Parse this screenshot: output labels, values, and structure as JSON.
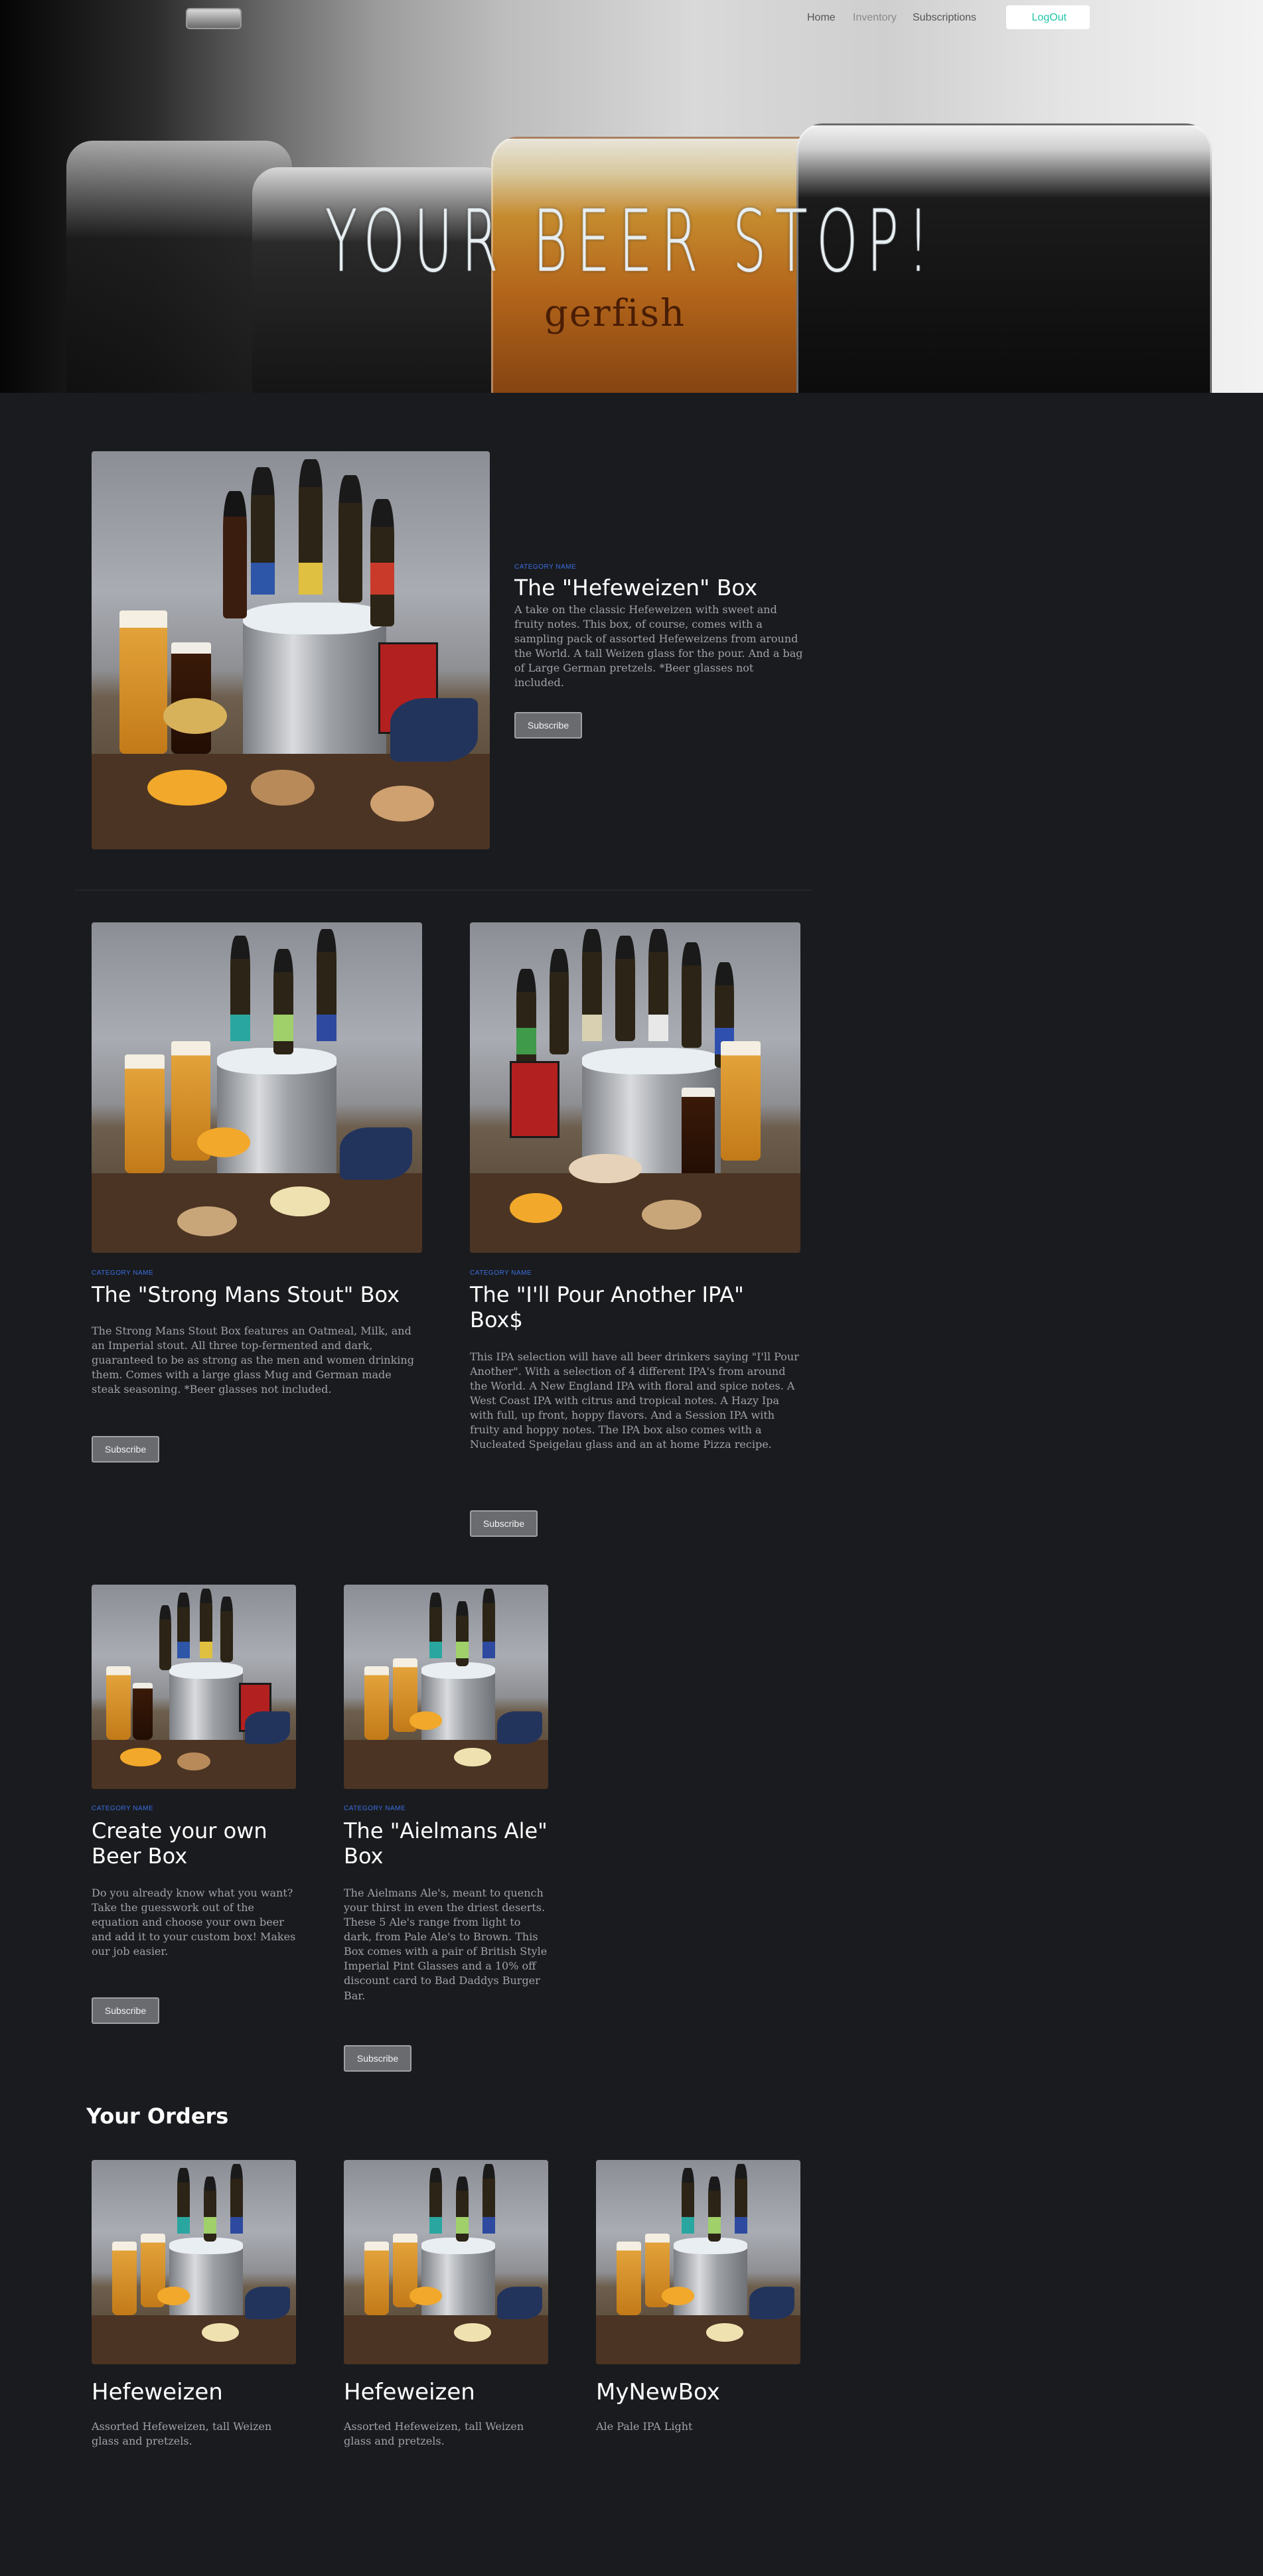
{
  "nav": {
    "links": [
      "Home",
      "Inventory",
      "Subscriptions"
    ],
    "logout_label": "LogOut"
  },
  "hero": {
    "title": "YOUR BEER STOP!",
    "glass_label": "gerfish"
  },
  "products": [
    {
      "category": "CATEGORY NAME",
      "title": "The \"Hefeweizen\" Box",
      "description": "A take on the classic Hefeweizen with sweet and fruity notes. This box, of course, comes with a sampling pack of assorted Hefeweizens from around the World. A tall Weizen glass for the pour. And a bag of Large German pretzels. *Beer glasses not included.",
      "button": "Subscribe"
    },
    {
      "category": "CATEGORY NAME",
      "title": "The \"Strong Mans Stout\" Box",
      "description": "The Strong Mans Stout Box features an Oatmeal, Milk, and an Imperial stout. All three top-fermented and dark, guaranteed to be as strong as the men and women drinking them. Comes with a large glass Mug and German made steak seasoning. *Beer glasses not included.",
      "button": "Subscribe"
    },
    {
      "category": "CATEGORY NAME",
      "title": "The \"I'll Pour Another IPA\" Box$",
      "description": "This IPA selection will have all beer drinkers saying \"I'll Pour Another\". With a selection of 4 different IPA's from around the World. A New England IPA with floral and spice notes. A West Coast IPA with citrus and tropical notes. A Hazy Ipa with full, up front, hoppy flavors. And a Session IPA with fruity and hoppy notes. The IPA box also comes with a Nucleated Speigelau glass and an at home Pizza recipe.",
      "button": "Subscribe"
    },
    {
      "category": "CATEGORY NAME",
      "title": "Create your own Beer Box",
      "description": "Do you already know what you want? Take the guesswork out of the equation and choose your own beer and add it to your custom box! Makes our job easier.",
      "button": "Subscribe"
    },
    {
      "category": "CATEGORY NAME",
      "title": "The \"Aielmans Ale\" Box",
      "description": "The Aielmans Ale's, meant to quench your thirst in even the driest deserts. These 5 Ale's range from light to dark, from Pale Ale's to Brown. This Box comes with a pair of British Style Imperial Pint Glasses and a 10% off discount card to Bad Daddys Burger Bar.",
      "button": "Subscribe"
    }
  ],
  "orders": {
    "heading": "Your Orders",
    "items": [
      {
        "title": "Hefeweizen",
        "description": "Assorted Hefeweizen, tall Weizen glass and pretzels."
      },
      {
        "title": "Hefeweizen",
        "description": "Assorted Hefeweizen, tall Weizen glass and pretzels."
      },
      {
        "title": "MyNewBox",
        "description": "Ale Pale IPA Light"
      }
    ]
  }
}
